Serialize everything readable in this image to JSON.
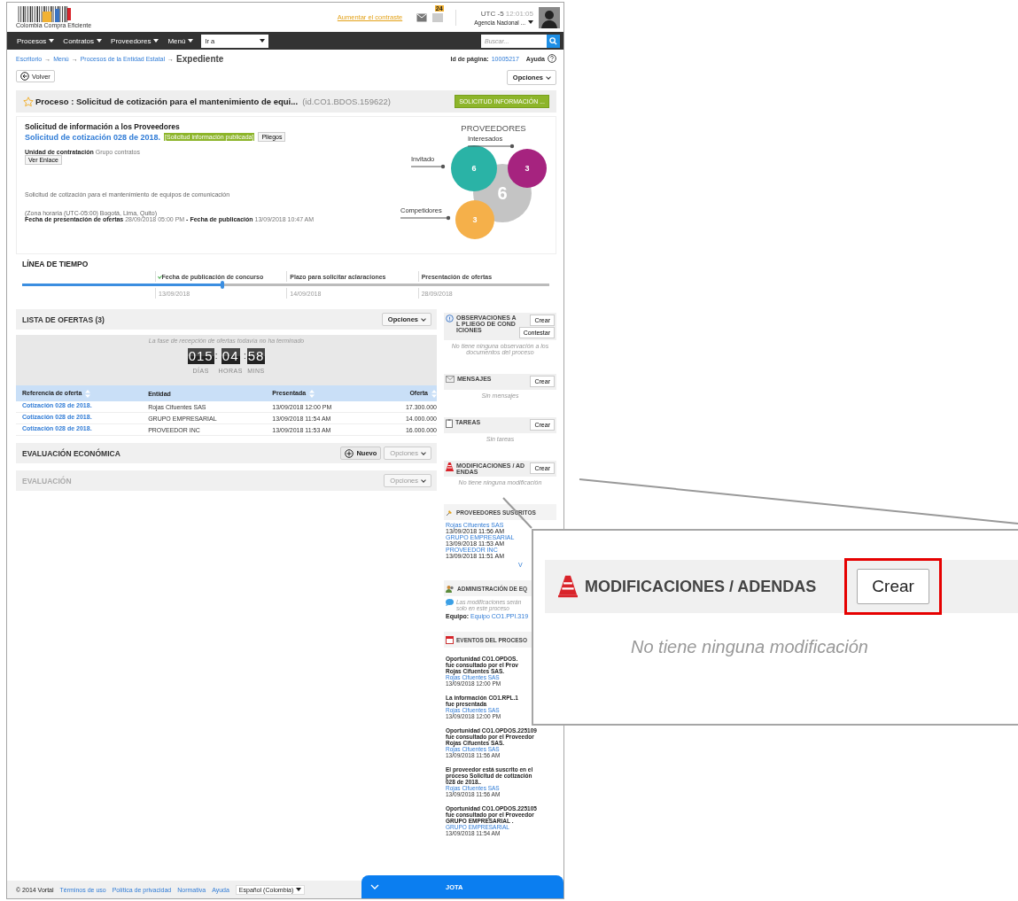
{
  "header": {
    "logo_text": "Colombia Compra Eficiente",
    "contrast_link": "Aumentar el contraste",
    "notification_count": "24",
    "timezone": "UTC -5",
    "time": "12:01:05",
    "agency": "Agencia Nacional ..."
  },
  "nav": {
    "menus": [
      {
        "label": "Procesos"
      },
      {
        "label": "Contratos"
      },
      {
        "label": "Proveedores"
      },
      {
        "label": "Menú"
      }
    ],
    "goto": {
      "value": "Ir a"
    },
    "search": {
      "placeholder": "Buscar..."
    }
  },
  "breadcrumb": {
    "links": [
      "Escritorio",
      "Menú",
      "Procesos de la Entidad Estatal"
    ],
    "separator": "→",
    "current": "Expediente"
  },
  "page_id": {
    "label": "Id de página:",
    "value": "10005217"
  },
  "help": "Ayuda",
  "back_button": "Volver",
  "options_button": "Opciones",
  "process": {
    "starred": false,
    "title": "Proceso : Solicitud de cotización para el mantenimiento de equi...",
    "id": "(id.CO1.BDOS.159622)",
    "status": "SOLICITUD INFORMACIÓN ..."
  },
  "summary": {
    "heading": "Solicitud de información a los Proveedores",
    "reference": "Solicitud de cotización 028 de 2018.",
    "badge": "[Solicitud información publicada]",
    "pliegos_button": "Pliegos",
    "unit_label": "Unidad de contratación",
    "unit_value": "Grupo contratos",
    "link_button": "Ver Enlace",
    "description": "Solicitud de cotización para el mantenimiento de equipos de comunicación",
    "timezone": "(Zona horaria (UTC-05:00) Bogotá, Lima, Quito)",
    "dates": "**Fecha de presentación de ofertas** 28/09/2018 05:00 PM **- Fecha de publicación** 13/09/2018 10:47 AM"
  },
  "providers": {
    "title": "PROVEEDORES",
    "bubbles": [
      {
        "label": "Interesados",
        "count": "3",
        "color": "#a6237f"
      },
      {
        "label": "Invitado",
        "count": "6",
        "color": "#2ab3a6"
      },
      {
        "count": "6",
        "color": "#c4c4c4"
      },
      {
        "label": "Competidores",
        "count": "3",
        "color": "#f5b04a"
      }
    ]
  },
  "timeline": {
    "title": "LÍNEA DE TIEMPO",
    "level": 0.38,
    "milestones": [
      {
        "label": "Fecha de publicación de concurso",
        "date": "13/09/2018",
        "done": true
      },
      {
        "label": "Plazo para solicitar aclaraciones",
        "date": "14/09/2018",
        "done": false
      },
      {
        "label": "Presentación de ofertas",
        "date": "28/09/2018",
        "done": false
      }
    ]
  },
  "offers": {
    "title": "LISTA DE OFERTAS (3)",
    "options": "Opciones",
    "notice": "La fase de recepción de ofertas todavía no ha terminado",
    "separator": ":",
    "countdown": [
      {
        "digits": "015",
        "unit": "DÍAS"
      },
      {
        "digits": "04",
        "unit": "HORAS"
      },
      {
        "digits": "58",
        "unit": "MINS"
      }
    ],
    "columns": [
      {
        "label": "Referencia de oferta",
        "sortable": true
      },
      {
        "label": "Entidad",
        "sortable": false
      },
      {
        "label": "Presentada",
        "sortable": true
      },
      {
        "label": "Oferta",
        "sortable": true
      }
    ],
    "rows": [
      [
        "Cotización 028 de 2018.",
        "Rojas Cifuentes SAS",
        "13/09/2018 12:00 PM",
        "17.300.000"
      ],
      [
        "Cotización 028 de 2018.",
        "GRUPO EMPRESARIAL",
        "13/09/2018 11:54 AM",
        "14.000.000"
      ],
      [
        "Cotización 028 de 2018.",
        "PROVEEDOR INC",
        "13/09/2018 11:53 AM",
        "16.000.000"
      ]
    ]
  },
  "evaluations": [
    {
      "title": "EVALUACIÓN ECONÓMICA",
      "new_button": "Nuevo",
      "options": "Opciones",
      "disabled": false
    },
    {
      "title": "EVALUACIÓN",
      "options": "Opciones",
      "disabled": true
    }
  ],
  "panels": [
    {
      "title": "OBSERVACIONES AL PLIEGO DE CONDICIONES",
      "buttons": [
        "Crear",
        "Contestar"
      ],
      "empty": "No tiene ninguna observación a los documentos del proceso"
    },
    {
      "title": "MENSAJES",
      "buttons": [
        "Crear"
      ],
      "empty": "Sin mensajes"
    },
    {
      "title": "TAREAS",
      "buttons": [
        "Crear"
      ],
      "empty": "Sin tareas"
    },
    {
      "title": "MODIFICACIONES / ADENDAS",
      "buttons": [
        "Crear"
      ],
      "empty": "No tiene ninguna modificación"
    }
  ],
  "subscribed": {
    "title": "PROVEEDORES SUSCRITOS",
    "items": [
      {
        "name": "Rojas Cifuentes SAS",
        "date": "13/09/2018 11:56 AM"
      },
      {
        "name": "GRUPO EMPRESARIAL",
        "date": "13/09/2018 11:53 AM"
      },
      {
        "name": "PROVEEDOR INC",
        "date": "13/09/2018 11:51 AM"
      }
    ],
    "more": "V"
  },
  "admin": {
    "title": "ADMINISTRACIÓN DE EQ",
    "note": [
      "Las modificaciones serán",
      "solo en este proceso"
    ],
    "team_label": "Equipo:",
    "team": "Equipo CO1.PPI.319"
  },
  "events": {
    "title": "EVENTOS DEL PROCESO",
    "items": [
      {
        "lines": [
          "Oportunidad CO1.OPDOS.",
          "fue consultado por el Prov",
          "Rojas Cifuentes SAS."
        ],
        "by": "Rojas Cifuentes SAS",
        "date": "13/09/2018 12:00 PM"
      },
      {
        "lines": [
          "La información CO1.RPL.1",
          "fue presentada"
        ],
        "by": "Rojas Cifuentes SAS",
        "date": "13/09/2018 12:00 PM"
      },
      {
        "lines": [
          "Oportunidad CO1.OPDOS.225109",
          "fue consultado por el Proveedor",
          "Rojas Cifuentes SAS."
        ],
        "by": "Rojas Cifuentes SAS",
        "date": "13/09/2018 11:56 AM"
      },
      {
        "lines": [
          "El proveedor está suscrito en el",
          "proceso Solicitud de cotización",
          "028 de 2018.."
        ],
        "by": "Rojas Cifuentes SAS",
        "date": "13/09/2018 11:56 AM"
      },
      {
        "lines": [
          "Oportunidad CO1.OPDOS.225105",
          "fue consultado por el Proveedor",
          "GRUPO EMPRESARIAL ."
        ],
        "by": "GRUPO EMPRESARIAL",
        "date": "13/09/2018 11:54 AM"
      }
    ]
  },
  "footer": {
    "copyright": "© 2014 Vortal",
    "links": [
      "Términos de uso",
      "Política de privacidad",
      "Normativa",
      "Ayuda"
    ],
    "language": "Español (Colombia)"
  },
  "chat": {
    "title": "JOTA"
  },
  "callout": {
    "title": "MODIFICACIONES / ADENDAS",
    "button": "Crear",
    "highlighted": true,
    "empty": "No tiene ninguna modificación"
  }
}
